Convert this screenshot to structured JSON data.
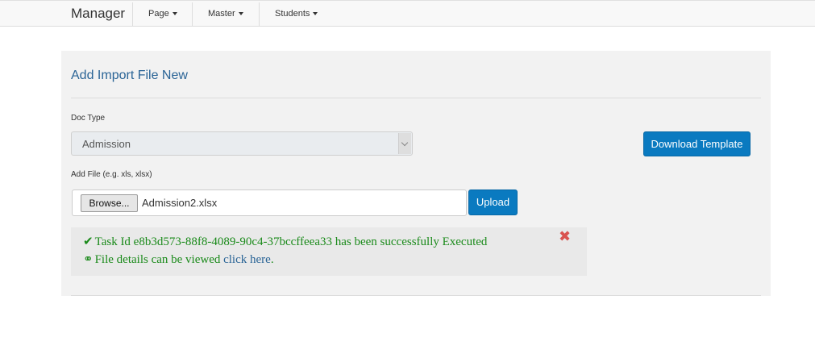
{
  "navbar": {
    "brand": "Manager",
    "items": [
      {
        "label": "Page"
      },
      {
        "label": "Master"
      },
      {
        "label": "Students"
      }
    ]
  },
  "panel": {
    "title": "Add Import File New",
    "doc_type_label": "Doc Type",
    "doc_type_value": "Admission",
    "download_template_label": "Download Template",
    "add_file_label": "Add File (e.g. xls, xlsx)",
    "browse_label": "Browse...",
    "file_name": "Admission2.xlsx",
    "upload_label": "Upload"
  },
  "alert": {
    "line1": "Task Id e8b3d573-88f8-4089-90c4-37bccffeea33 has been successfully Executed",
    "line2_prefix": "File details can be viewed ",
    "line2_link": "click here",
    "line2_suffix": ".",
    "close_symbol": "✖",
    "check_icon": "✔",
    "link_icon": "⚭"
  },
  "colors": {
    "accent": "#0a7ac0",
    "success": "#1a8a1a",
    "danger": "#d9534f",
    "title": "#2a6496"
  }
}
